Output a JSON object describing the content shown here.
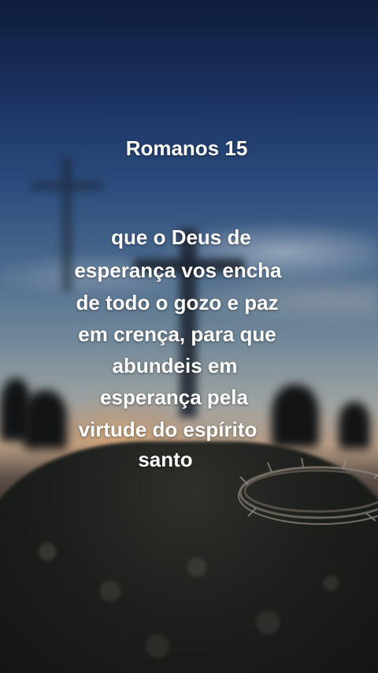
{
  "verse": {
    "reference": "Romanos 15",
    "lines": [
      "que o Deus de",
      "esperança vos encha",
      "de todo o gozo e paz",
      "em crença, para que",
      "abundeis em",
      "esperança pela",
      "virtude do espírito",
      "santo"
    ]
  },
  "background": {
    "description_icons": [
      "cross-silhouette-icon",
      "crown-of-thorns-icon"
    ],
    "colors": {
      "sky_top": "#0f1d3b",
      "sky_mid": "#4d6b8e",
      "horizon": "#b99f86",
      "ground": "#1c1d1c",
      "text": "#ffffff"
    }
  }
}
